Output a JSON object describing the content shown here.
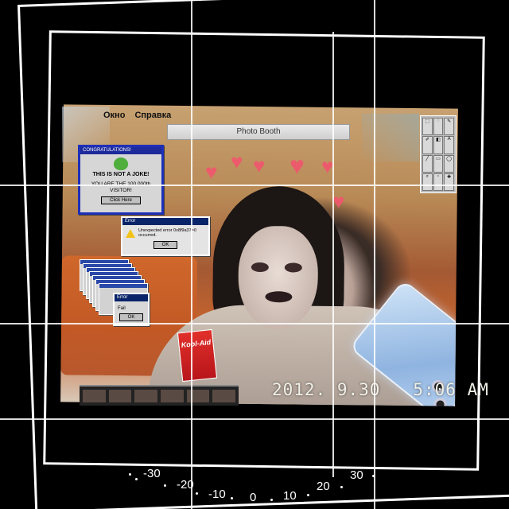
{
  "menubar": {
    "items": [
      "Окно",
      "Справка"
    ]
  },
  "app_title": "Photo Booth",
  "congrats_window": {
    "title": "CONGRATULATIONS!",
    "headline": "THIS IS NOT A JOKE!",
    "message_line1": "YOU ARE THE 100,000th",
    "message_line2": "VISITOR!",
    "button": "Click Here"
  },
  "error_window": {
    "title": "Error",
    "message": "Unexpected error 0x8f9a37=0 occurred.",
    "button": "OK"
  },
  "fail_window": {
    "title": "Error",
    "message": "Fail",
    "button": "OK"
  },
  "koolaid_label": "Kool-Aid",
  "timestamp": {
    "date": "2012. 9.30",
    "time": "5:06 AM"
  },
  "dial_labels": [
    "-30",
    "-20",
    "-10",
    "0",
    "10",
    "20",
    "30"
  ],
  "colors": {
    "accent": "#1c2a9c",
    "heart": "#f2566e"
  }
}
